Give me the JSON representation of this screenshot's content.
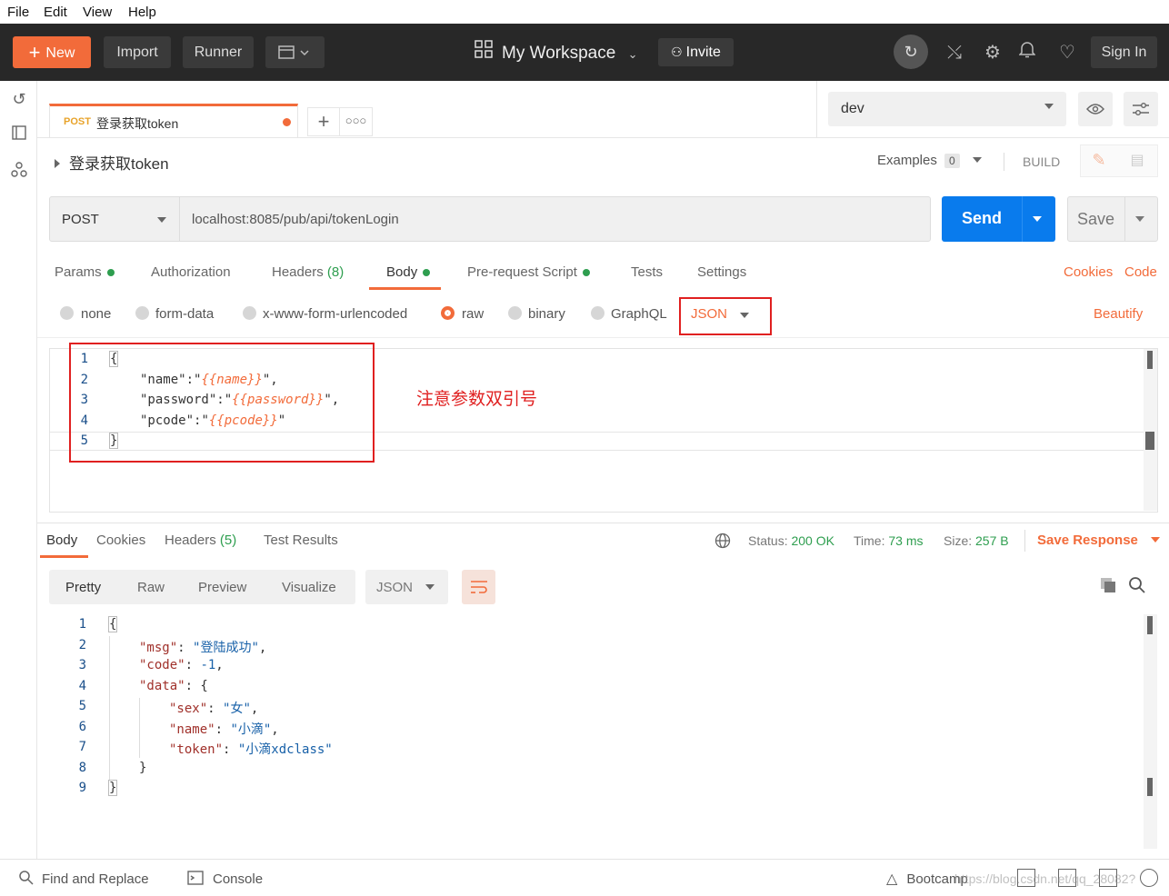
{
  "menu": {
    "file": "File",
    "edit": "Edit",
    "view": "View",
    "help": "Help"
  },
  "header": {
    "new_label": "New",
    "import_label": "Import",
    "runner_label": "Runner",
    "workspace_label": "My Workspace",
    "invite_label": "Invite",
    "signin_label": "Sign In"
  },
  "tab": {
    "method": "POST",
    "name": "登录获取token"
  },
  "environment": {
    "selected": "dev"
  },
  "request": {
    "title": "登录获取token",
    "examples_label": "Examples",
    "examples_count": "0",
    "build_label": "BUILD",
    "method": "POST",
    "url": "localhost:8085/pub/api/tokenLogin",
    "send_label": "Send",
    "save_label": "Save"
  },
  "req_tabs": {
    "params": "Params",
    "authorization": "Authorization",
    "headers": "Headers",
    "headers_count": "(8)",
    "body": "Body",
    "prerequest": "Pre-request Script",
    "tests": "Tests",
    "settings": "Settings",
    "cookies": "Cookies",
    "code": "Code"
  },
  "body_modes": {
    "none": "none",
    "form_data": "form-data",
    "urlencoded": "x-www-form-urlencoded",
    "raw": "raw",
    "binary": "binary",
    "graphql": "GraphQL",
    "format": "JSON",
    "beautify": "Beautify"
  },
  "request_body": {
    "line_numbers": [
      "1",
      "2",
      "3",
      "4",
      "5"
    ],
    "l1": "{",
    "l2_key": "\"name\"",
    "l2_val": "{{name}}",
    "l3_key": "\"password\"",
    "l3_val": "{{password}}",
    "l4_key": "\"pcode\"",
    "l4_val": "{{pcode}}",
    "l5": "}"
  },
  "annotation": {
    "text": "注意参数双引号",
    "color": "#e02020"
  },
  "response": {
    "tabs": {
      "body": "Body",
      "cookies": "Cookies",
      "headers": "Headers",
      "headers_count": "(5)",
      "test_results": "Test Results"
    },
    "status_label": "Status:",
    "status_value": "200 OK",
    "time_label": "Time:",
    "time_value": "73 ms",
    "size_label": "Size:",
    "size_value": "257 B",
    "save_response": "Save Response",
    "views": {
      "pretty": "Pretty",
      "raw": "Raw",
      "preview": "Preview",
      "visualize": "Visualize",
      "format": "JSON"
    },
    "line_numbers": [
      "1",
      "2",
      "3",
      "4",
      "5",
      "6",
      "7",
      "8",
      "9"
    ],
    "msg_key": "\"msg\"",
    "msg_val": "\"登陆成功\"",
    "code_key": "\"code\"",
    "code_val": "-1",
    "data_key": "\"data\"",
    "sex_key": "\"sex\"",
    "sex_val": "\"女\"",
    "name_key": "\"name\"",
    "name_val": "\"小滴\"",
    "token_key": "\"token\"",
    "token_val": "\"小滴xdclass\""
  },
  "footer": {
    "find_replace": "Find and Replace",
    "console": "Console",
    "bootcamp": "Bootcamp",
    "watermark": "https://blog.csdn.net/qq_28082?"
  },
  "colors": {
    "accent": "#f26b3a",
    "send": "#097bed",
    "header_bg": "#282828",
    "success": "#2e9e4f"
  }
}
